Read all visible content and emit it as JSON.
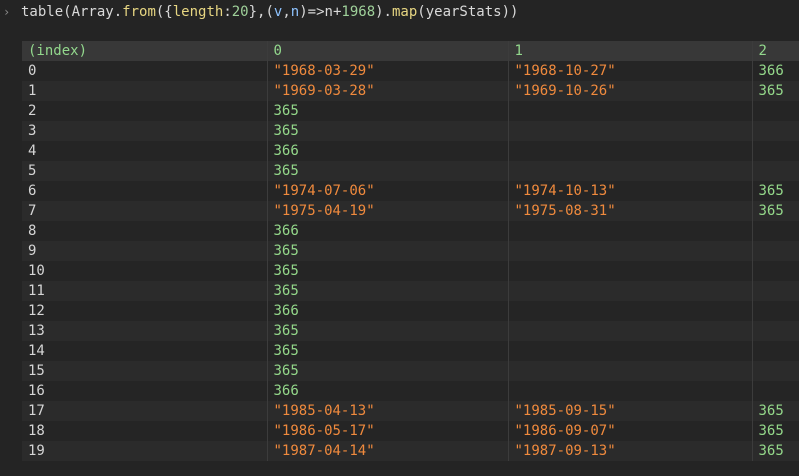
{
  "command": {
    "prefix": "table(Array.",
    "from": "from",
    "open_obj": "({",
    "length_key": "length",
    "colon": ": ",
    "length_value": "20",
    "close_obj": "}",
    "comma": ", ",
    "open_param": "(",
    "v": "v",
    "comma2": ",",
    "n": "n",
    "close_param": ")",
    "arrow": " => ",
    "n_expr": "n",
    "plus": " + ",
    "base": "1968",
    "close_from": ").",
    "map": "map",
    "suffix": "(yearStats))"
  },
  "table": {
    "headers": [
      "(index)",
      "0",
      "1",
      "2"
    ],
    "rows": [
      {
        "index": "0",
        "c0": "\"1968-03-29\"",
        "c1": "\"1968-10-27\"",
        "c2": "366"
      },
      {
        "index": "1",
        "c0": "\"1969-03-28\"",
        "c1": "\"1969-10-26\"",
        "c2": "365"
      },
      {
        "index": "2",
        "c0": "365",
        "c1": "",
        "c2": ""
      },
      {
        "index": "3",
        "c0": "365",
        "c1": "",
        "c2": ""
      },
      {
        "index": "4",
        "c0": "366",
        "c1": "",
        "c2": ""
      },
      {
        "index": "5",
        "c0": "365",
        "c1": "",
        "c2": ""
      },
      {
        "index": "6",
        "c0": "\"1974-07-06\"",
        "c1": "\"1974-10-13\"",
        "c2": "365"
      },
      {
        "index": "7",
        "c0": "\"1975-04-19\"",
        "c1": "\"1975-08-31\"",
        "c2": "365"
      },
      {
        "index": "8",
        "c0": "366",
        "c1": "",
        "c2": ""
      },
      {
        "index": "9",
        "c0": "365",
        "c1": "",
        "c2": ""
      },
      {
        "index": "10",
        "c0": "365",
        "c1": "",
        "c2": ""
      },
      {
        "index": "11",
        "c0": "365",
        "c1": "",
        "c2": ""
      },
      {
        "index": "12",
        "c0": "366",
        "c1": "",
        "c2": ""
      },
      {
        "index": "13",
        "c0": "365",
        "c1": "",
        "c2": ""
      },
      {
        "index": "14",
        "c0": "365",
        "c1": "",
        "c2": ""
      },
      {
        "index": "15",
        "c0": "365",
        "c1": "",
        "c2": ""
      },
      {
        "index": "16",
        "c0": "366",
        "c1": "",
        "c2": ""
      },
      {
        "index": "17",
        "c0": "\"1985-04-13\"",
        "c1": "\"1985-09-15\"",
        "c2": "365"
      },
      {
        "index": "18",
        "c0": "\"1986-05-17\"",
        "c1": "\"1986-09-07\"",
        "c2": "365"
      },
      {
        "index": "19",
        "c0": "\"1987-04-14\"",
        "c1": "\"1987-09-13\"",
        "c2": "365"
      }
    ]
  }
}
